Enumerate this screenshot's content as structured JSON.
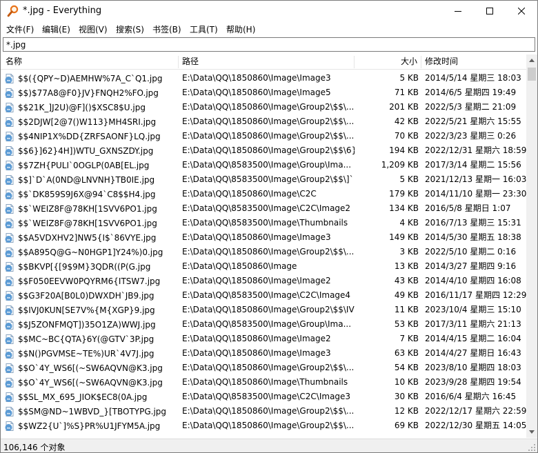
{
  "window": {
    "title": "*.jpg - Everything",
    "colors": {
      "accent": "#0063b1",
      "jpg_icon": "#5b9bd5",
      "app_icon": "#e8731a"
    }
  },
  "menu": [
    {
      "label": "文件(F)"
    },
    {
      "label": "编辑(E)"
    },
    {
      "label": "视图(V)"
    },
    {
      "label": "搜索(S)"
    },
    {
      "label": "书签(B)"
    },
    {
      "label": "工具(T)"
    },
    {
      "label": "帮助(H)"
    }
  ],
  "search": {
    "value": "*.jpg"
  },
  "columns": {
    "name": "名称",
    "path": "路径",
    "size": "大小",
    "modified": "修改时间"
  },
  "rows": [
    {
      "name": "$$({QPY~D)AEMHW%7A_C`Q1.jpg",
      "path": "E:\\Data\\QQ\\1850860\\Image\\Image3",
      "size": "5 KB",
      "modified": "2014/5/14 星期三 18:03"
    },
    {
      "name": "$$)$77A8@F0}JV}FNQH2%FO.jpg",
      "path": "E:\\Data\\QQ\\1850860\\Image\\Image5",
      "size": "71 KB",
      "modified": "2014/6/5 星期四 19:49"
    },
    {
      "name": "$$21K_]J2U)@F]()$XSC8$U.jpg",
      "path": "E:\\Data\\QQ\\1850860\\Image\\Group2\\$$\\...",
      "size": "201 KB",
      "modified": "2022/5/3 星期二 21:09"
    },
    {
      "name": "$$2DJW[2@7()W113}MH4SRI.jpg",
      "path": "E:\\Data\\QQ\\1850860\\Image\\Group2\\$$\\...",
      "size": "42 KB",
      "modified": "2022/5/21 星期六 15:55"
    },
    {
      "name": "$$4NIP1X%DD{ZRFSAONF}LQ.jpg",
      "path": "E:\\Data\\QQ\\1850860\\Image\\Group2\\$$\\...",
      "size": "70 KB",
      "modified": "2022/3/23 星期三 0:26"
    },
    {
      "name": "$$6}]62}4H])WTU_GXNSZDY.jpg",
      "path": "E:\\Data\\QQ\\1850860\\Image\\Group2\\$$\\6}",
      "size": "194 KB",
      "modified": "2022/12/31 星期六 18:59"
    },
    {
      "name": "$$7ZH{PULI`0OGLP(0AB[EL.jpg",
      "path": "E:\\Data\\QQ\\8583500\\Image\\Group\\Ima...",
      "size": "1,209 KB",
      "modified": "2017/3/14 星期二 15:56"
    },
    {
      "name": "$$]`D`A(0ND@LNVNH}TB0IE.jpg",
      "path": "E:\\Data\\QQ\\8583500\\Image\\Group2\\$$\\]`",
      "size": "5 KB",
      "modified": "2021/12/13 星期一 16:03"
    },
    {
      "name": "$$`DK859S9J6X@94`C8$$H4.jpg",
      "path": "E:\\Data\\QQ\\1850860\\Image\\C2C",
      "size": "179 KB",
      "modified": "2014/11/10 星期一 23:30"
    },
    {
      "name": "$$`WEIZ8F@78KH[1SVV6PO1.jpg",
      "path": "E:\\Data\\QQ\\8583500\\Image\\C2C\\Image2",
      "size": "134 KB",
      "modified": "2016/5/8 星期日 1:07"
    },
    {
      "name": "$$`WEIZ8F@78KH[1SVV6PO1.jpg",
      "path": "E:\\Data\\QQ\\8583500\\Image\\Thumbnails",
      "size": "4 KB",
      "modified": "2016/7/13 星期三 15:31"
    },
    {
      "name": "$$A5VDXHV2]NW5{I$`86VYE.jpg",
      "path": "E:\\Data\\QQ\\1850860\\Image\\Image3",
      "size": "149 KB",
      "modified": "2014/5/30 星期五 18:38"
    },
    {
      "name": "$$A895Q@G~N0HGP1]Y24%)0.jpg",
      "path": "E:\\Data\\QQ\\1850860\\Image\\Group2\\$$\\...",
      "size": "3 KB",
      "modified": "2022/5/10 星期二 0:16"
    },
    {
      "name": "$$BKVP[{[9$9M}3QDR((P(G.jpg",
      "path": "E:\\Data\\QQ\\1850860\\Image",
      "size": "13 KB",
      "modified": "2014/3/27 星期四 9:16"
    },
    {
      "name": "$$F050EEVW0PQYRM6{ITSW7.jpg",
      "path": "E:\\Data\\QQ\\1850860\\Image\\Image2",
      "size": "43 KB",
      "modified": "2014/4/10 星期四 16:08"
    },
    {
      "name": "$$G3F20A[B0L0)DWXDH`JB9.jpg",
      "path": "E:\\Data\\QQ\\8583500\\Image\\C2C\\Image4",
      "size": "49 KB",
      "modified": "2016/11/17 星期四 12:29"
    },
    {
      "name": "$$IVJ0KUN[SE7V%{M{XGP}9.jpg",
      "path": "E:\\Data\\QQ\\1850860\\Image\\Group2\\$$\\IV",
      "size": "11 KB",
      "modified": "2023/10/4 星期三 15:10"
    },
    {
      "name": "$$J5ZONFMQT])35O1ZA)WWJ.jpg",
      "path": "E:\\Data\\QQ\\8583500\\Image\\Group\\Ima...",
      "size": "53 KB",
      "modified": "2017/3/11 星期六 21:13"
    },
    {
      "name": "$$MC~BC{QTA}6Y(@GTV`3P.jpg",
      "path": "E:\\Data\\QQ\\1850860\\Image\\Image2",
      "size": "7 KB",
      "modified": "2014/4/15 星期二 16:04"
    },
    {
      "name": "$$N()PGVMSE~TE%)UR`4V7J.jpg",
      "path": "E:\\Data\\QQ\\1850860\\Image\\Image3",
      "size": "63 KB",
      "modified": "2014/4/27 星期日 16:43"
    },
    {
      "name": "$$O`4Y_WS6[(~SW6AQVN@K3.jpg",
      "path": "E:\\Data\\QQ\\1850860\\Image\\Group2\\$$\\...",
      "size": "54 KB",
      "modified": "2023/8/10 星期四 18:03"
    },
    {
      "name": "$$O`4Y_WS6[(~SW6AQVN@K3.jpg",
      "path": "E:\\Data\\QQ\\1850860\\Image\\Thumbnails",
      "size": "10 KB",
      "modified": "2023/9/28 星期四 19:54"
    },
    {
      "name": "$$SL_MX_695_JIOK$EC8(0A.jpg",
      "path": "E:\\Data\\QQ\\8583500\\Image\\C2C\\Image3",
      "size": "30 KB",
      "modified": "2016/6/4 星期六 16:45"
    },
    {
      "name": "$$SM@ND~1WBVD_}[TBOTYPG.jpg",
      "path": "E:\\Data\\QQ\\1850860\\Image\\Group2\\$$\\...",
      "size": "12 KB",
      "modified": "2022/12/17 星期六 22:59"
    },
    {
      "name": "$$WZ2{U`]%S}PR%U1JFYM5A.jpg",
      "path": "E:\\Data\\QQ\\1850860\\Image\\Group2\\$$\\...",
      "size": "69 KB",
      "modified": "2022/12/30 星期五 14:05"
    }
  ],
  "status": {
    "text": "106,146 个对象"
  }
}
